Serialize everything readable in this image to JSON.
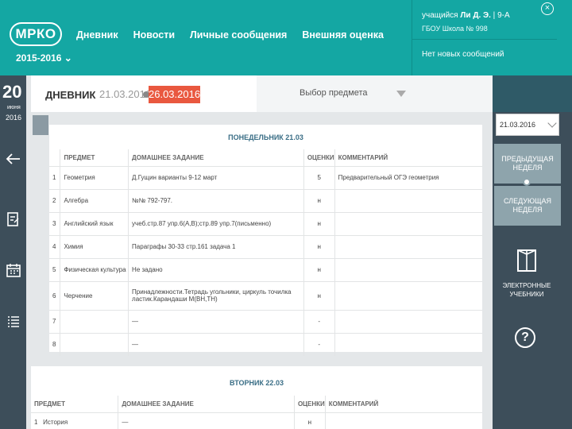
{
  "brand": {
    "logo": "МРКО",
    "year": "2015-2016"
  },
  "nav": [
    "Дневник",
    "Новости",
    "Личные сообщения",
    "Внешняя оценка"
  ],
  "user": {
    "role": "учащийся",
    "name": "Ли Д. Э.",
    "class": "9-А",
    "school": "ГБОУ Школа № 998",
    "messages": "Нет новых сообщений",
    "close": "×"
  },
  "left": {
    "day": "20",
    "month": "июня",
    "year": "2016"
  },
  "header": {
    "title": "ДНЕВНИК",
    "date_from": "21.03.2016",
    "date_to": "26.03.2016",
    "subject_select": "Выбор предмета"
  },
  "right": {
    "date_value": "21.03.2016",
    "prev_week": "ПРЕДЫДУЩАЯ НЕДЕЛЯ",
    "next_week": "СЛЕДУЮЩАЯ НЕДЕЛЯ",
    "ebooks": "ЭЛЕКТРОННЫЕ УЧЕБНИКИ",
    "help": "?"
  },
  "columns": {
    "subject": "ПРЕДМЕТ",
    "homework": "ДОМАШНЕЕ ЗАДАНИЕ",
    "grades": "ОЦЕНКИ",
    "comment": "КОММЕНТАРИЙ"
  },
  "days": [
    {
      "title": "ПОНЕДЕЛЬНИК 21.03",
      "lessons": [
        {
          "num": "1",
          "subject": "Геометрия",
          "homework": "Д.Гущин варианты 9-12 март",
          "grade": "5",
          "comment": "Предварительный ОГЭ геометрия"
        },
        {
          "num": "2",
          "subject": "Алгебра",
          "homework": "№№ 792-797.",
          "grade": "н",
          "comment": ""
        },
        {
          "num": "3",
          "subject": "Английский язык",
          "homework": "учеб.стр.87 упр.6(A,B);стр.89 упр.7(письменно)",
          "grade": "н",
          "comment": ""
        },
        {
          "num": "4",
          "subject": "Химия",
          "homework": "Параграфы 30-33 стр.161 задача 1",
          "grade": "н",
          "comment": ""
        },
        {
          "num": "5",
          "subject": "Физическая культура",
          "homework": "Не задано",
          "grade": "н",
          "comment": ""
        },
        {
          "num": "6",
          "subject": "Черчение",
          "homework": "Принадлежности.Тетрадь угольники, циркуль точилка ластик.Карандаши М(ВН,ТН)",
          "grade": "н",
          "comment": ""
        },
        {
          "num": "7",
          "subject": "",
          "homework": "—",
          "grade": "-",
          "comment": ""
        },
        {
          "num": "8",
          "subject": "",
          "homework": "—",
          "grade": "-",
          "comment": ""
        }
      ]
    },
    {
      "title": "ВТОРНИК 22.03",
      "lessons": [
        {
          "num": "1",
          "subject": "История",
          "homework": "—",
          "grade": "н",
          "comment": ""
        }
      ]
    }
  ],
  "colors": {
    "teal": "#14a7a3",
    "sidebar": "#3d4e5a",
    "accent": "#e9583f",
    "week_button": "#8ea4ac"
  }
}
